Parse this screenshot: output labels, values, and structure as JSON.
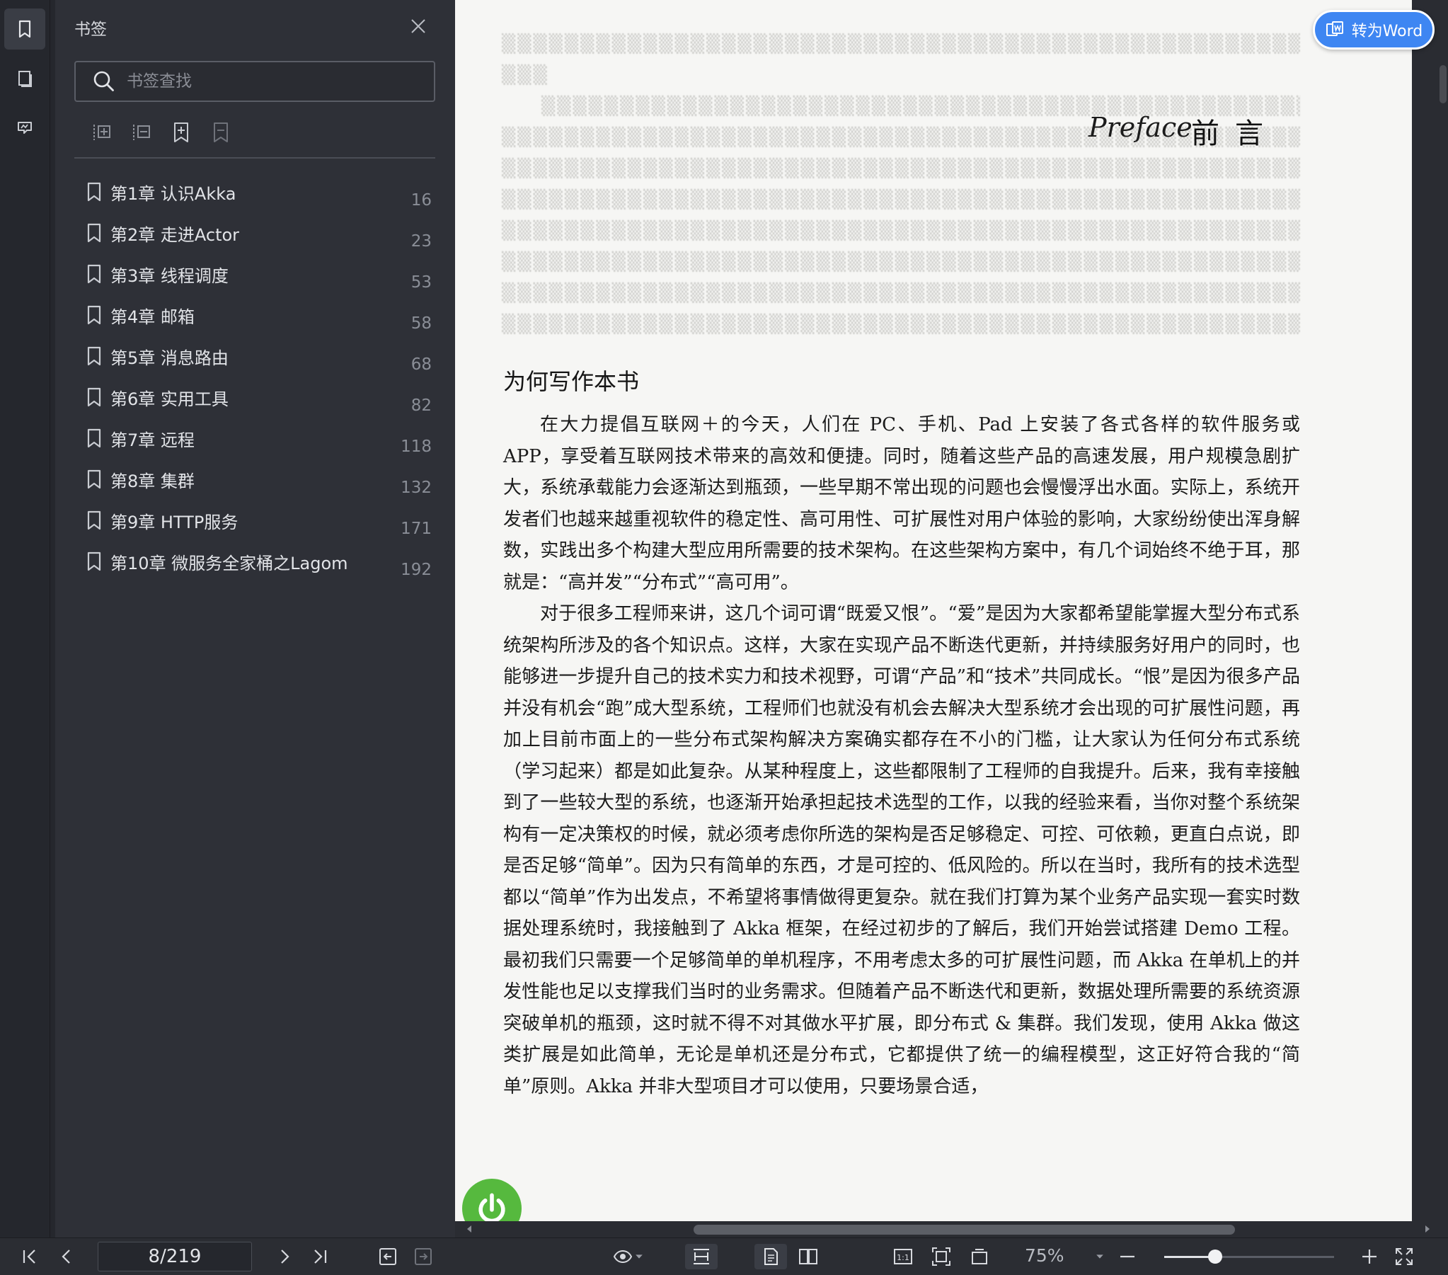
{
  "sidebar": {
    "panel_title": "书签",
    "search_placeholder": "书签查找",
    "bookmarks": [
      {
        "label": "第1章 认识Akka",
        "page": "16"
      },
      {
        "label": "第2章 走进Actor",
        "page": "23"
      },
      {
        "label": "第3章 线程调度",
        "page": "53"
      },
      {
        "label": "第4章 邮箱",
        "page": "58"
      },
      {
        "label": "第5章 消息路由",
        "page": "68"
      },
      {
        "label": "第6章 实用工具",
        "page": "82"
      },
      {
        "label": "第7章 远程",
        "page": "118"
      },
      {
        "label": "第8章 集群",
        "page": "132"
      },
      {
        "label": "第9章 HTTP服务",
        "page": "171"
      },
      {
        "label": "第10章 微服务全家桶之Lagom",
        "page": "192"
      }
    ]
  },
  "document": {
    "convert_button": "转为Word",
    "preface_script": "Preface",
    "preface_title": "前言",
    "section_heading": "为何写作本书",
    "paragraphs": [
      "在大力提倡互联网＋的今天，人们在 PC、手机、Pad 上安装了各式各样的软件服务或 APP，享受着互联网技术带来的高效和便捷。同时，随着这些产品的高速发展，用户规模急剧扩大，系统承载能力会逐渐达到瓶颈，一些早期不常出现的问题也会慢慢浮出水面。实际上，系统开发者们也越来越重视软件的稳定性、高可用性、可扩展性对用户体验的影响，大家纷纷使出浑身解数，实践出多个构建大型应用所需要的技术架构。在这些架构方案中，有几个词始终不绝于耳，那就是：“高并发”“分布式”“高可用”。",
      "对于很多工程师来讲，这几个词可谓“既爱又恨”。“爱”是因为大家都希望能掌握大型分布式系统架构所涉及的各个知识点。这样，大家在实现产品不断迭代更新，并持续服务好用户的同时，也能够进一步提升自己的技术实力和技术视野，可谓“产品”和“技术”共同成长。“恨”是因为很多产品并没有机会“跑”成大型系统，工程师们也就没有机会去解决大型系统才会出现的可扩展性问题，再加上目前市面上的一些分布式架构解决方案确实都存在不小的门槛，让大家认为任何分布式系统（学习起来）都是如此复杂。从某种程度上，这些都限制了工程师的自我提升。后来，我有幸接触到了一些较大型的系统，也逐渐开始承担起技术选型的工作，以我的经验来看，当你对整个系统架构有一定决策权的时候，就必须考虑你所选的架构是否足够稳定、可控、可依赖，更直白点说，即是否足够“简单”。因为只有简单的东西，才是可控的、低风险的。所以在当时，我所有的技术选型都以“简单”作为出发点，不希望将事情做得更复杂。就在我们打算为某个业务产品实现一套实时数据处理系统时，我接触到了 Akka 框架，在经过初步的了解后，我们开始尝试搭建 Demo 工程。最初我们只需要一个足够简单的单机程序，不用考虑太多的可扩展性问题，而 Akka 在单机上的并发性能也足以支撑我们当时的业务需求。但随着产品不断迭代和更新，数据处理所需要的系统资源突破单机的瓶颈，这时就不得不对其做水平扩展，即分布式 & 集群。我们发现，使用 Akka 做这类扩展是如此简单，无论是单机还是分布式，它都提供了统一的编程模型，这正好符合我的“简单”原则。Akka 并非大型项目才可以使用，只要场景合适，"
    ]
  },
  "toolbar": {
    "page_indicator": "8/219",
    "zoom_label": "75%",
    "zoom_fraction": 0.3
  },
  "colors": {
    "accent": "#3e86f2",
    "power_green": "#56b93e"
  }
}
